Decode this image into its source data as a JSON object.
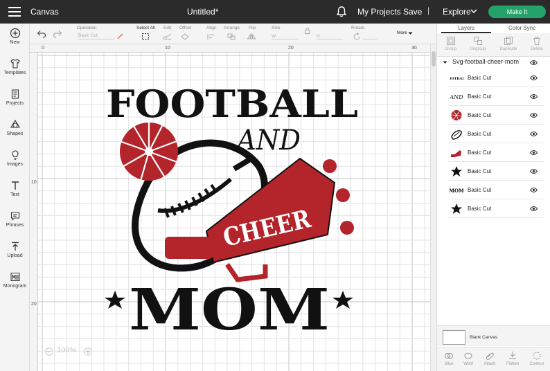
{
  "topbar": {
    "app_name": "Canvas",
    "doc_title": "Untitled*",
    "my_projects": "My Projects",
    "save": "Save",
    "separator": "|",
    "explore": "Explore",
    "make_it": "Make It"
  },
  "left_toolbar": [
    {
      "label": "New",
      "icon": "plus-circle-icon"
    },
    {
      "label": "Templates",
      "icon": "shirt-icon"
    },
    {
      "label": "Projects",
      "icon": "projects-icon"
    },
    {
      "label": "Shapes",
      "icon": "shapes-icon"
    },
    {
      "label": "Images",
      "icon": "lightbulb-icon"
    },
    {
      "label": "Text",
      "icon": "text-icon"
    },
    {
      "label": "Phrases",
      "icon": "speech-bubble-icon"
    },
    {
      "label": "Upload",
      "icon": "upload-icon"
    },
    {
      "label": "Monogram",
      "icon": "monogram-icon"
    }
  ],
  "edit_toolbar": {
    "operation_label": "Operation",
    "operation_value": "Basic Cut",
    "select_all": "Select All",
    "edit": "Edit",
    "offset": "Offset",
    "align": "Align",
    "arrange": "Arrange",
    "flip": "Flip",
    "size": "Size",
    "size_w": "W",
    "size_h": "H",
    "rotate": "Rotate",
    "more": "More"
  },
  "canvas": {
    "ruler_top": [
      "0",
      "10",
      "20",
      "30"
    ],
    "ruler_left": [
      "10",
      "20"
    ],
    "zoom": "100%",
    "design": {
      "line1": "FOOTBALL",
      "line2": "AND",
      "line3": "CHEER",
      "line4": "MOM"
    },
    "colors": {
      "black": "#111111",
      "red": "#b3242b",
      "white": "#ffffff"
    }
  },
  "right_panel": {
    "tabs": [
      "Layers",
      "Color Sync"
    ],
    "actions": [
      "Group",
      "Ungroup",
      "Duplicate",
      "Delete"
    ],
    "group_name": "Svg-football-cheer-mom",
    "layers": [
      {
        "name": "Basic Cut",
        "thumb": "football-text-thumb"
      },
      {
        "name": "Basic Cut",
        "thumb": "and-text-thumb"
      },
      {
        "name": "Basic Cut",
        "thumb": "pompom-thumb"
      },
      {
        "name": "Basic Cut",
        "thumb": "football-outline-thumb"
      },
      {
        "name": "Basic Cut",
        "thumb": "megaphone-thumb"
      },
      {
        "name": "Basic Cut",
        "thumb": "star-thumb"
      },
      {
        "name": "Basic Cut",
        "thumb": "mom-text-thumb"
      },
      {
        "name": "Basic Cut",
        "thumb": "star-thumb"
      }
    ],
    "thumb_text": {
      "football": "FOOTBALL",
      "and": "AND",
      "mom": "MOM"
    },
    "blank_canvas": "Blank Canvas",
    "bottom_actions": [
      "Slice",
      "Weld",
      "Attach",
      "Flatten",
      "Contour"
    ]
  }
}
